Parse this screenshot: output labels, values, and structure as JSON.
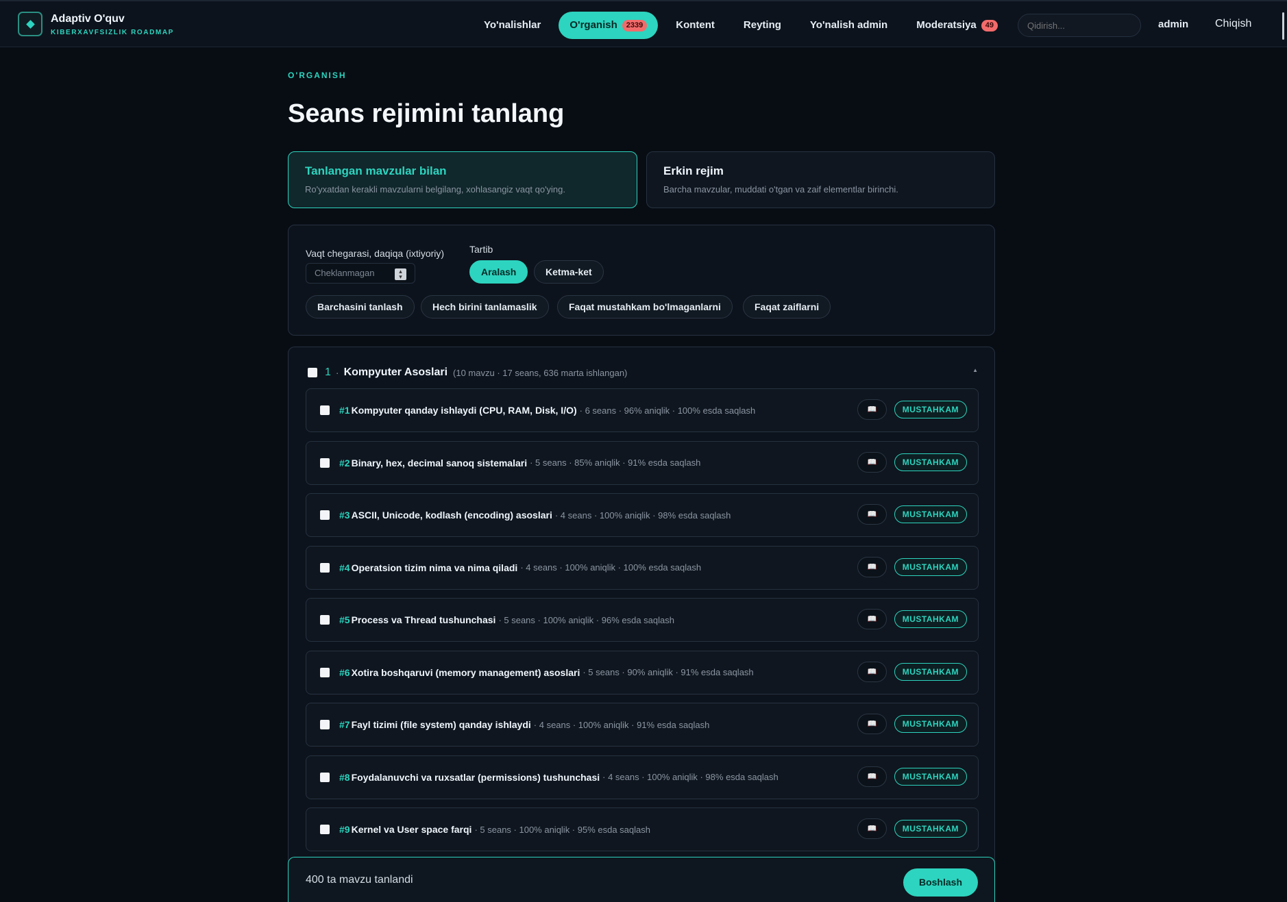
{
  "brand": {
    "title": "Adaptiv O'quv",
    "subtitle": "KIBERXAVFSIZLIK ROADMAP"
  },
  "nav": {
    "items": [
      {
        "label": "Yo'nalishlar"
      },
      {
        "label": "O'rganish",
        "badge": "2339",
        "active": true
      },
      {
        "label": "Kontent"
      },
      {
        "label": "Reyting"
      },
      {
        "label": "Yo'nalish admin"
      },
      {
        "label": "Moderatsiya",
        "badge": "49"
      }
    ],
    "search_placeholder": "Qidirish...",
    "user": "admin",
    "logout": "Chiqish"
  },
  "page": {
    "eyebrow": "O'RGANISH",
    "title": "Seans rejimini tanlang"
  },
  "modes": [
    {
      "title": "Tanlangan mavzular bilan",
      "desc": "Ro'yxatdan kerakli mavzularni belgilang, xohlasangiz vaqt qo'ying.",
      "selected": true
    },
    {
      "title": "Erkin rejim",
      "desc": "Barcha mavzular, muddati o'tgan va zaif elementlar birinchi.",
      "selected": false
    }
  ],
  "settings": {
    "time_label": "Vaqt chegarasi, daqiqa (ixtiyoriy)",
    "time_placeholder": "Cheklanmagan",
    "order_label": "Tartib",
    "order_options": [
      "Aralash",
      "Ketma-ket"
    ],
    "order_selected": "Aralash",
    "quick_actions": [
      "Barchasini tanlash",
      "Hech birini tanlamaslik",
      "Faqat mustahkam bo'lmaganlarni",
      "Faqat zaiflarni"
    ]
  },
  "group": {
    "number": "1",
    "name": "Kompyuter Asoslari",
    "meta": "(10 mavzu · 17 seans, 636 marta ishlangan)",
    "topics": [
      {
        "num": "#1",
        "title": "Kompyuter qanday ishlaydi (CPU, RAM, Disk, I/O)",
        "meta": "· 6 seans · 96% aniqlik · 100% esda saqlash",
        "status": "MUSTAHKAM"
      },
      {
        "num": "#2",
        "title": "Binary, hex, decimal sanoq sistemalari",
        "meta": "· 5 seans · 85% aniqlik · 91% esda saqlash",
        "status": "MUSTAHKAM"
      },
      {
        "num": "#3",
        "title": "ASCII, Unicode, kodlash (encoding) asoslari",
        "meta": "· 4 seans · 100% aniqlik · 98% esda saqlash",
        "status": "MUSTAHKAM"
      },
      {
        "num": "#4",
        "title": "Operatsion tizim nima va nima qiladi",
        "meta": "· 4 seans · 100% aniqlik · 100% esda saqlash",
        "status": "MUSTAHKAM"
      },
      {
        "num": "#5",
        "title": "Process va Thread tushunchasi",
        "meta": "· 5 seans · 100% aniqlik · 96% esda saqlash",
        "status": "MUSTAHKAM"
      },
      {
        "num": "#6",
        "title": "Xotira boshqaruvi (memory management) asoslari",
        "meta": "· 5 seans · 90% aniqlik · 91% esda saqlash",
        "status": "MUSTAHKAM"
      },
      {
        "num": "#7",
        "title": "Fayl tizimi (file system) qanday ishlaydi",
        "meta": "· 4 seans · 100% aniqlik · 91% esda saqlash",
        "status": "MUSTAHKAM"
      },
      {
        "num": "#8",
        "title": "Foydalanuvchi va ruxsatlar (permissions) tushunchasi",
        "meta": "· 4 seans · 100% aniqlik · 98% esda saqlash",
        "status": "MUSTAHKAM"
      },
      {
        "num": "#9",
        "title": "Kernel va User space farqi",
        "meta": "· 5 seans · 100% aniqlik · 95% esda saqlash",
        "status": "MUSTAHKAM"
      }
    ]
  },
  "footer": {
    "selected_text": "400 ta mavzu tanlandi",
    "start_label": "Boshlash"
  },
  "icons": {
    "logo": "diamond-icon",
    "book": "book-icon",
    "caret": "caret-up-icon",
    "spinner": "spinner-icon"
  },
  "colors": {
    "accent": "#2dd4bf",
    "badge": "#f26b6b",
    "background": "#080d14"
  }
}
